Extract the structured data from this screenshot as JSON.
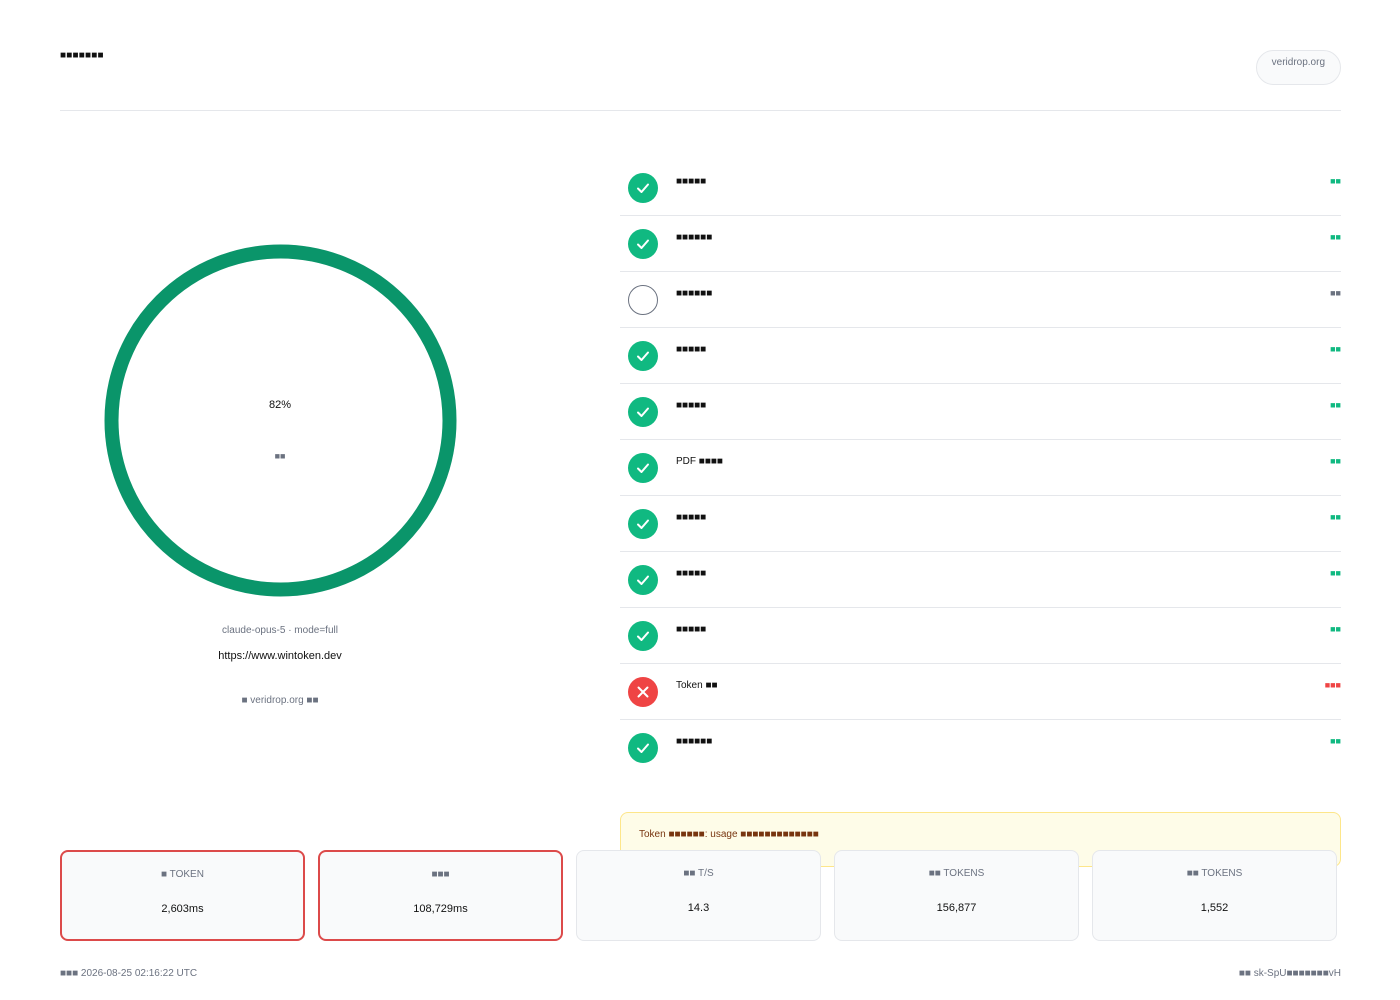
{
  "header": {
    "title": "■■■■■■■",
    "domain": "veridrop.org"
  },
  "gauge": {
    "percent_label": "82%",
    "percent_value": 0.82,
    "sub_label": "■■",
    "color": "#0a956a"
  },
  "meta": {
    "model_line": "claude-opus-5 · mode=full",
    "url": "https://www.wintoken.dev",
    "by_line": "■ veridrop.org ■■"
  },
  "checks": [
    {
      "label": "■■■■■",
      "status": "pass",
      "status_label": "■■",
      "icon": "check-icon"
    },
    {
      "label": "■■■■■■",
      "status": "pass",
      "status_label": "■■",
      "icon": "check-icon"
    },
    {
      "label": "■■■■■■",
      "status": "skip",
      "status_label": "■■",
      "icon": "empty-circle-icon"
    },
    {
      "label": "■■■■■",
      "status": "pass",
      "status_label": "■■",
      "icon": "check-icon"
    },
    {
      "label": "■■■■■",
      "status": "pass",
      "status_label": "■■",
      "icon": "check-icon"
    },
    {
      "label": "PDF ■■■■",
      "status": "pass",
      "status_label": "■■",
      "icon": "check-icon"
    },
    {
      "label": "■■■■■",
      "status": "pass",
      "status_label": "■■",
      "icon": "check-icon"
    },
    {
      "label": "■■■■■",
      "status": "pass",
      "status_label": "■■",
      "icon": "check-icon"
    },
    {
      "label": "■■■■■",
      "status": "pass",
      "status_label": "■■",
      "icon": "check-icon"
    },
    {
      "label": "Token ■■",
      "status": "fail",
      "status_label": "■■■",
      "icon": "x-icon"
    },
    {
      "label": "■■■■■■",
      "status": "pass",
      "status_label": "■■",
      "icon": "check-icon"
    }
  ],
  "warning": {
    "text": "Token ■■■■■■: usage ■■■■■■■■■■■■■"
  },
  "stats": [
    {
      "label": "■ TOKEN",
      "value": "2,603ms",
      "alert": true
    },
    {
      "label": "■■■",
      "value": "108,729ms",
      "alert": true
    },
    {
      "label": "■■ T/S",
      "value": "14.3",
      "alert": false
    },
    {
      "label": "■■ TOKENS",
      "value": "156,877",
      "alert": false
    },
    {
      "label": "■■ TOKENS",
      "value": "1,552",
      "alert": false
    }
  ],
  "footer": {
    "timestamp": "■■■ 2026-08-25 02:16:22 UTC",
    "key": "■■ sk-SpU■■■■■■■vH"
  },
  "colors": {
    "pass": "#10b981",
    "fail": "#ef4444",
    "alert_border": "#dc4a4a",
    "warning_bg": "#fefce8"
  }
}
